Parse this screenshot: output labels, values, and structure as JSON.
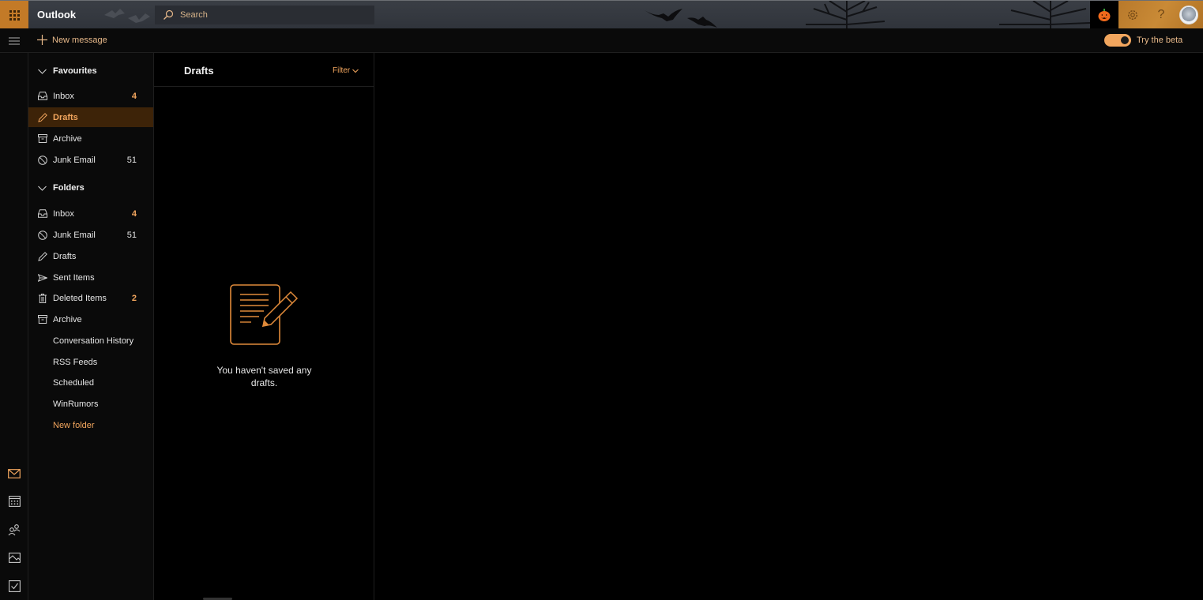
{
  "app": {
    "title": "Outlook",
    "search_placeholder": "Search",
    "accent_color": "#f2a65e",
    "theme": "Halloween"
  },
  "header_icons": [
    "app-launcher-icon",
    "pumpkin-icon",
    "settings-gear-icon",
    "help-icon",
    "user-avatar"
  ],
  "commandbar": {
    "new_message_label": "New message",
    "try_beta_label": "Try the beta",
    "beta_toggle_on": true
  },
  "rail": {
    "items": [
      {
        "name": "mail",
        "active": true
      },
      {
        "name": "calendar",
        "active": false
      },
      {
        "name": "people",
        "active": false
      },
      {
        "name": "photos",
        "active": false
      },
      {
        "name": "tasks",
        "active": false
      }
    ]
  },
  "favourites": {
    "label": "Favourites",
    "items": [
      {
        "label": "Inbox",
        "icon": "inbox",
        "count": "4",
        "unread": true
      },
      {
        "label": "Drafts",
        "icon": "pencil",
        "count": "",
        "selected": true
      },
      {
        "label": "Archive",
        "icon": "archive",
        "count": ""
      },
      {
        "label": "Junk Email",
        "icon": "blocked",
        "count": "51"
      }
    ]
  },
  "folders": {
    "label": "Folders",
    "items": [
      {
        "label": "Inbox",
        "icon": "inbox",
        "count": "4",
        "unread": true
      },
      {
        "label": "Junk Email",
        "icon": "blocked",
        "count": "51"
      },
      {
        "label": "Drafts",
        "icon": "pencil",
        "count": ""
      },
      {
        "label": "Sent Items",
        "icon": "send",
        "count": ""
      },
      {
        "label": "Deleted Items",
        "icon": "trash",
        "count": "2",
        "unread": true
      },
      {
        "label": "Archive",
        "icon": "archive",
        "count": ""
      },
      {
        "label": "Conversation History",
        "icon": "",
        "count": ""
      },
      {
        "label": "RSS Feeds",
        "icon": "",
        "count": ""
      },
      {
        "label": "Scheduled",
        "icon": "",
        "count": ""
      },
      {
        "label": "WinRumors",
        "icon": "",
        "count": ""
      }
    ],
    "new_folder_label": "New folder"
  },
  "message_list": {
    "title": "Drafts",
    "filter_label": "Filter",
    "empty_message": "You haven't saved any drafts."
  }
}
